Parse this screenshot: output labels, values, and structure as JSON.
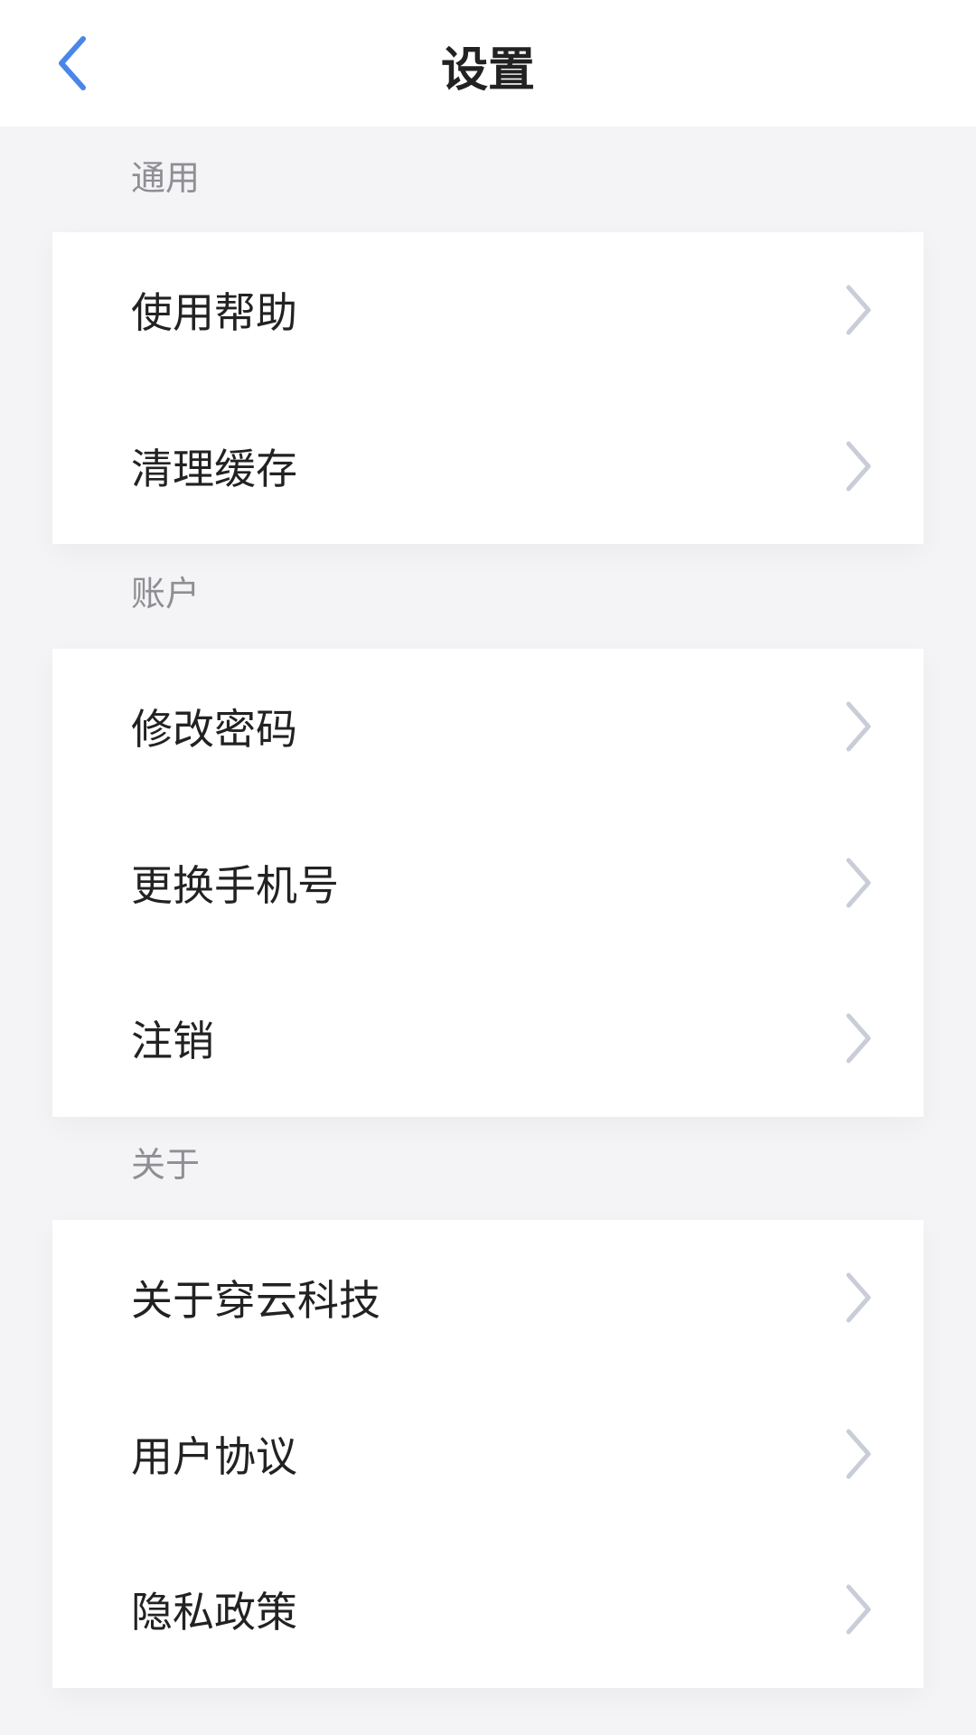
{
  "nav": {
    "title": "设置",
    "back_icon": "chevron-left-icon",
    "accent": "#4a86e8"
  },
  "sections": [
    {
      "header": "通用",
      "items": [
        {
          "label": "使用帮助"
        },
        {
          "label": "清理缓存"
        }
      ]
    },
    {
      "header": "账户",
      "items": [
        {
          "label": "修改密码"
        },
        {
          "label": "更换手机号"
        },
        {
          "label": "注销"
        }
      ]
    },
    {
      "header": "关于",
      "items": [
        {
          "label": "关于穿云科技"
        },
        {
          "label": "用户协议"
        },
        {
          "label": "隐私政策"
        }
      ]
    }
  ],
  "row_icon": "chevron-right-icon",
  "colors": {
    "background": "#f4f4f6",
    "card": "#ffffff",
    "chevron": "#c8cdd8",
    "header_text": "#8e8e93",
    "primary_text": "#222222"
  }
}
